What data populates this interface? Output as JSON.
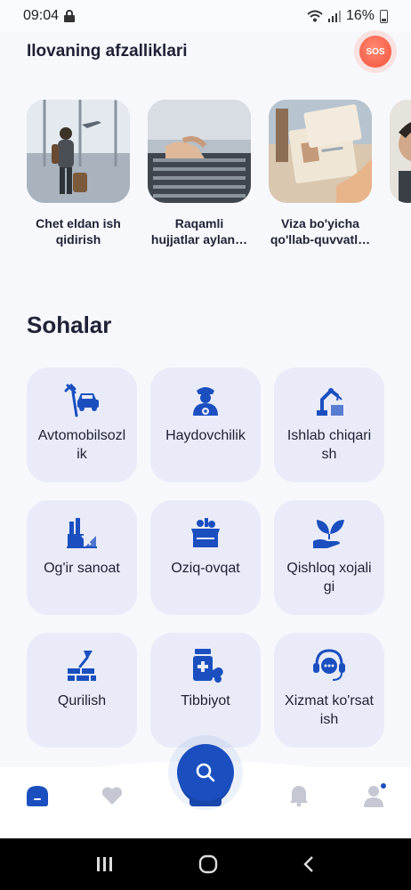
{
  "status": {
    "time": "09:04",
    "battery": "16%"
  },
  "header": {
    "title": "Ilovaning afzalliklari",
    "sos_label": "SOS"
  },
  "features": [
    {
      "line1": "Chet eldan ish",
      "line2": "qidirish"
    },
    {
      "line1": "Raqamli",
      "line2": "hujjatlar aylan…"
    },
    {
      "line1": "Viza bo'yicha",
      "line2": "qo'llab-quvvatl…"
    }
  ],
  "section": {
    "title": "Sohalar"
  },
  "sectors": [
    {
      "label": "Avtomobilsozlik",
      "icon": "car-repair-icon"
    },
    {
      "label": "Haydovchilik",
      "icon": "driver-icon"
    },
    {
      "label": "Ishlab chiqarish",
      "icon": "robot-arm-icon"
    },
    {
      "label": "Og'ir sanoat",
      "icon": "factory-icon"
    },
    {
      "label": "Oziq-ovqat",
      "icon": "grocery-box-icon"
    },
    {
      "label": "Qishloq xojaligi",
      "icon": "plant-hand-icon"
    },
    {
      "label": "Qurilish",
      "icon": "trowel-bricks-icon"
    },
    {
      "label": "Tibbiyot",
      "icon": "medicine-icon"
    },
    {
      "label": "Xizmat ko'rsatish",
      "icon": "support-headset-icon"
    }
  ],
  "colors": {
    "accent": "#1b4fc0",
    "tile_bg": "#e9ecf8",
    "sos": "#f2503a"
  }
}
